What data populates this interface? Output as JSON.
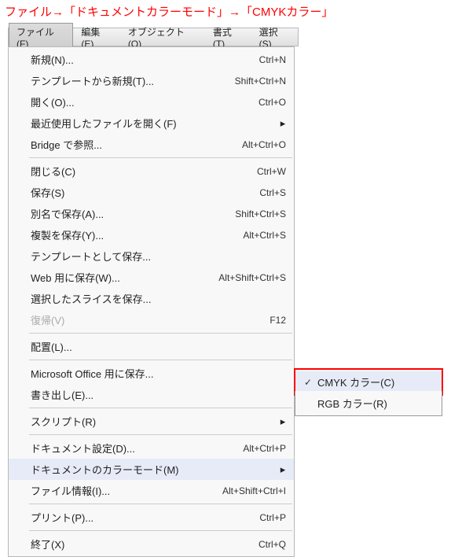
{
  "instruction": "ファイル→「ドキュメントカラーモード」→「CMYKカラー」",
  "menubar": {
    "file": "ファイル(F)",
    "edit": "編集(E)",
    "object": "オブジェクト(O)",
    "format": "書式(T)",
    "select": "選択(S)"
  },
  "menu": {
    "new": {
      "label": "新規(N)...",
      "short": "Ctrl+N"
    },
    "newTemplate": {
      "label": "テンプレートから新規(T)...",
      "short": "Shift+Ctrl+N"
    },
    "open": {
      "label": "開く(O)...",
      "short": "Ctrl+O"
    },
    "recent": {
      "label": "最近使用したファイルを開く(F)",
      "short": "",
      "arrow": "▸"
    },
    "bridge": {
      "label": "Bridge で参照...",
      "short": "Alt+Ctrl+O"
    },
    "close": {
      "label": "閉じる(C)",
      "short": "Ctrl+W"
    },
    "save": {
      "label": "保存(S)",
      "short": "Ctrl+S"
    },
    "saveAs": {
      "label": "別名で保存(A)...",
      "short": "Shift+Ctrl+S"
    },
    "saveCopy": {
      "label": "複製を保存(Y)...",
      "short": "Alt+Ctrl+S"
    },
    "saveTemplate": {
      "label": "テンプレートとして保存...",
      "short": ""
    },
    "saveWeb": {
      "label": "Web 用に保存(W)...",
      "short": "Alt+Shift+Ctrl+S"
    },
    "saveSlice": {
      "label": "選択したスライスを保存...",
      "short": ""
    },
    "revert": {
      "label": "復帰(V)",
      "short": "F12"
    },
    "place": {
      "label": "配置(L)...",
      "short": ""
    },
    "msoffice": {
      "label": "Microsoft Office 用に保存...",
      "short": ""
    },
    "export": {
      "label": "書き出し(E)...",
      "short": ""
    },
    "script": {
      "label": "スクリプト(R)",
      "short": "",
      "arrow": "▸"
    },
    "docSetup": {
      "label": "ドキュメント設定(D)...",
      "short": "Alt+Ctrl+P"
    },
    "colorMode": {
      "label": "ドキュメントのカラーモード(M)",
      "short": "",
      "arrow": "▸"
    },
    "fileInfo": {
      "label": "ファイル情報(I)...",
      "short": "Alt+Shift+Ctrl+I"
    },
    "print": {
      "label": "プリント(P)...",
      "short": "Ctrl+P"
    },
    "quit": {
      "label": "終了(X)",
      "short": "Ctrl+Q"
    }
  },
  "submenu": {
    "cmyk": {
      "label": "CMYK カラー(C)",
      "check": "✓"
    },
    "rgb": {
      "label": "RGB カラー(R)",
      "check": ""
    }
  }
}
